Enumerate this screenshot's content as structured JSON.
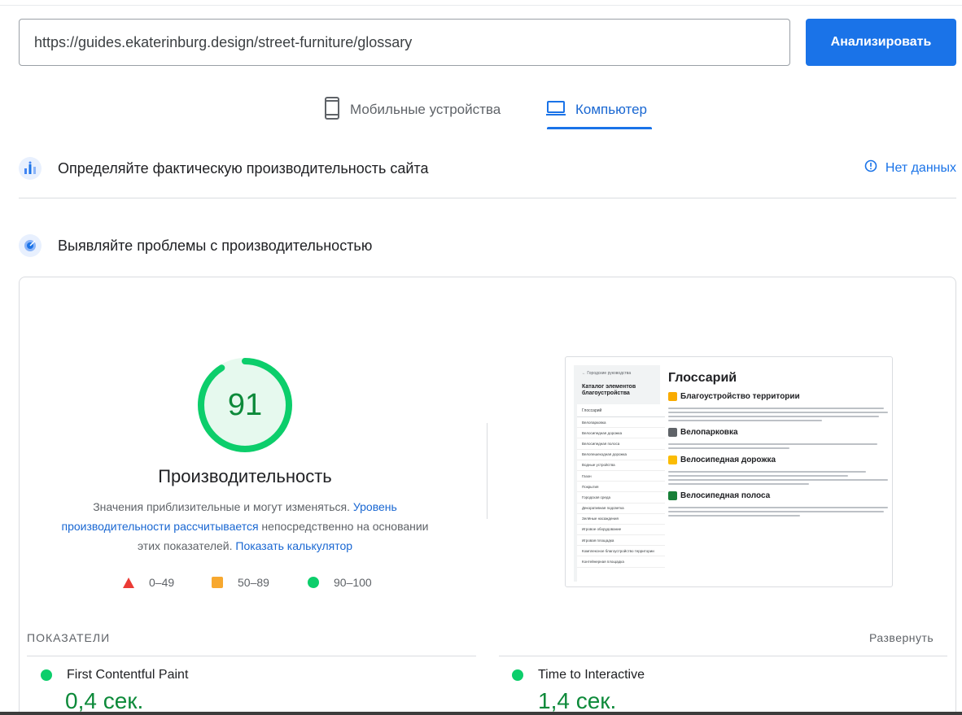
{
  "url_input": {
    "value": "https://guides.ekaterinburg.design/street-furniture/glossary"
  },
  "analyze_button": "Анализировать",
  "tabs": [
    {
      "label": "Мобильные устройства",
      "icon": "smartphone-icon",
      "selected": false
    },
    {
      "label": "Компьютер",
      "icon": "laptop-icon",
      "selected": true
    }
  ],
  "field_data": {
    "title": "Определяйте фактическую производительность сайта",
    "icon": "field-data-chart-icon",
    "status": "Нет данных",
    "status_icon": "info-icon"
  },
  "lab_data": {
    "title": "Выявляйте проблемы с производительностью",
    "icon": "lab-data-target-icon"
  },
  "score": {
    "value": 91,
    "value_text": "91",
    "fraction": 0.91,
    "label": "Производительность",
    "color": "#0cce6b",
    "desc_part1": "Значения приблизительные и могут изменяться. ",
    "desc_link1": "Уровень производительности рассчитывается",
    "desc_part2": " непосредственно на основании этих показателей. ",
    "desc_link2": "Показать калькулятор"
  },
  "legend": [
    {
      "range": "0–49",
      "shape": "triangle",
      "color": "#eb3b35"
    },
    {
      "range": "50–89",
      "shape": "square",
      "color": "#f7a82f"
    },
    {
      "range": "90–100",
      "shape": "circle",
      "color": "#0cce6b"
    }
  ],
  "preview": {
    "back_link": "← Городские руководства",
    "catalog_title": "Каталог элементов благоустройства",
    "menu_items": [
      "Глоссарий",
      "Велопарковка",
      "Велосипедная дорожка",
      "Велосипедная полоса",
      "Велопешеходная дорожка",
      "Водные устройства",
      "Газон",
      "Покрытия",
      "Городская среда",
      "Декоративная подсветка",
      "Зелёные насаждения",
      "Игровое оборудование",
      "Игровая площадка",
      "Комплексное благоустройство территории",
      "Контейнерная площадка"
    ],
    "heading": "Глоссарий",
    "sections": [
      {
        "title": "Благоустройство территории",
        "emoji_color": "#f9ab00",
        "lines": 4
      },
      {
        "title": "Велопарковка",
        "emoji_color": "#5f6368",
        "lines": 2
      },
      {
        "title": "Велосипедная дорожка",
        "emoji_color": "#fbbc04",
        "lines": 4
      },
      {
        "title": "Велосипедная полоса",
        "emoji_color": "#188038",
        "lines": 3
      }
    ]
  },
  "metrics": {
    "label": "ПОКАЗАТЕЛИ",
    "expand": "Развернуть",
    "items": [
      {
        "name": "First Contentful Paint",
        "value": "0,4 сек.",
        "color": "#0cce6b"
      },
      {
        "name": "Time to Interactive",
        "value": "1,4 сек.",
        "color": "#0cce6b"
      }
    ]
  }
}
